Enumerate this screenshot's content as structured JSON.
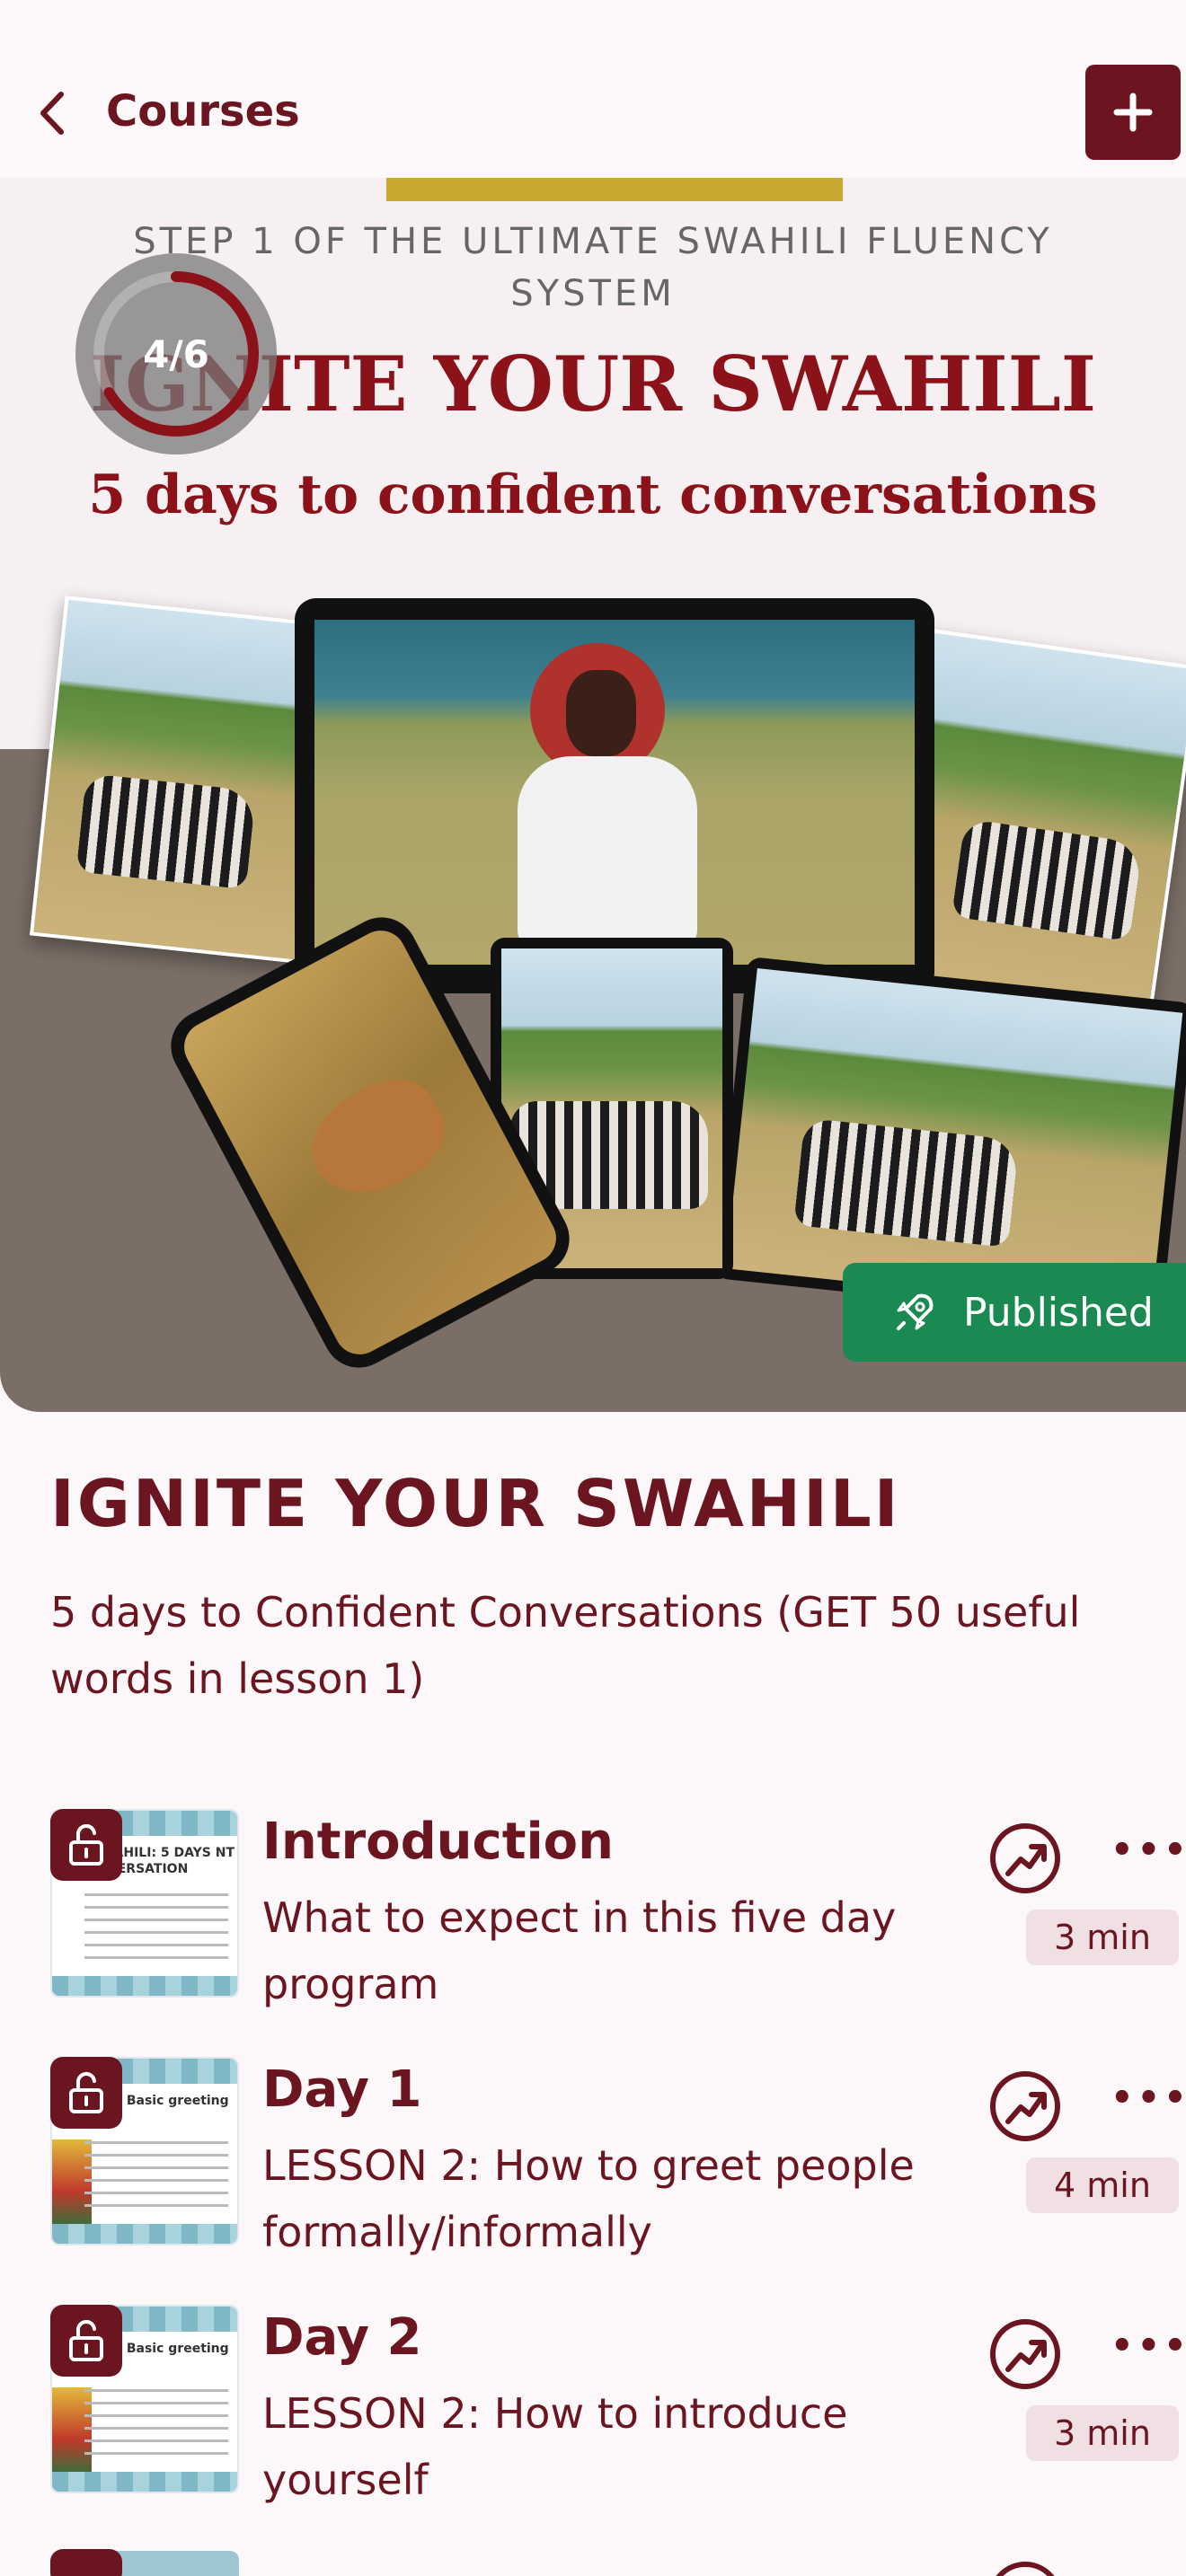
{
  "topbar": {
    "back_label": "Courses",
    "add_icon": "plus-icon"
  },
  "hero": {
    "step_text": "STEP 1 OF THE ULTIMATE SWAHILI FLUENCY SYSTEM",
    "title": "IGNITE YOUR SWAHILI",
    "subtitle": "5 days to confident conversations",
    "progress": {
      "label": "4/6",
      "completed": 4,
      "total": 6
    },
    "status_badge": "Published"
  },
  "course": {
    "title": "IGNITE YOUR SWAHILI",
    "description": "5 days to Confident Conversations (GET 50 useful words in lesson 1)"
  },
  "lessons": [
    {
      "title": "Introduction",
      "subtitle": "What to expect in this five day program",
      "duration": "3 min",
      "thumb_text": "R SWAHILI: 5 DAYS NT CONVERSATION"
    },
    {
      "title": "Day 1",
      "subtitle": "LESSON 2: How to greet people formally/informally",
      "duration": "4 min",
      "thumb_text": "Day 1: Basic greeting"
    },
    {
      "title": "Day 2",
      "subtitle": "LESSON 2: How to introduce yourself",
      "duration": "3 min",
      "thumb_text": "Day 2: Basic greeting"
    }
  ],
  "colors": {
    "brand": "#6b1520",
    "published": "#1b8a52",
    "accent_yellow": "#c9a832"
  }
}
